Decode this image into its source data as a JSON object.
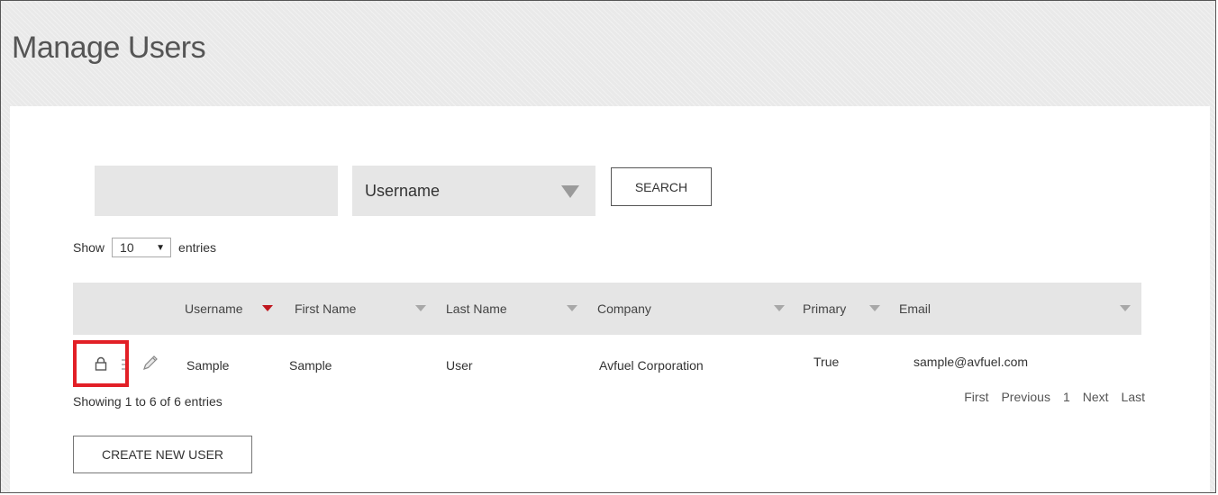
{
  "page": {
    "title": "Manage Users"
  },
  "search": {
    "input_value": "",
    "field_selected": "Username",
    "button_label": "SEARCH"
  },
  "entries": {
    "show_label": "Show",
    "value": "10",
    "suffix": "entries"
  },
  "table": {
    "columns": [
      "Username",
      "First Name",
      "Last Name",
      "Company",
      "Primary",
      "Email"
    ],
    "sorted_column": "Username",
    "rows": [
      {
        "username": "Sample",
        "first_name": "Sample",
        "last_name": "User",
        "company": "Avfuel Corporation",
        "primary": "True",
        "email": "sample@avfuel.com"
      }
    ]
  },
  "info": "Showing 1 to 6 of 6 entries",
  "pagination": {
    "first": "First",
    "previous": "Previous",
    "page": "1",
    "next": "Next",
    "last": "Last"
  },
  "actions": {
    "create_label": "CREATE NEW USER"
  },
  "row_icons": [
    "lock-icon",
    "drag-handle-icon",
    "pencil-icon"
  ],
  "colors": {
    "sort_active": "#c0171f",
    "highlight": "#e21f26",
    "panel_bg": "#ffffff",
    "header_bg": "#e5e5e5"
  }
}
